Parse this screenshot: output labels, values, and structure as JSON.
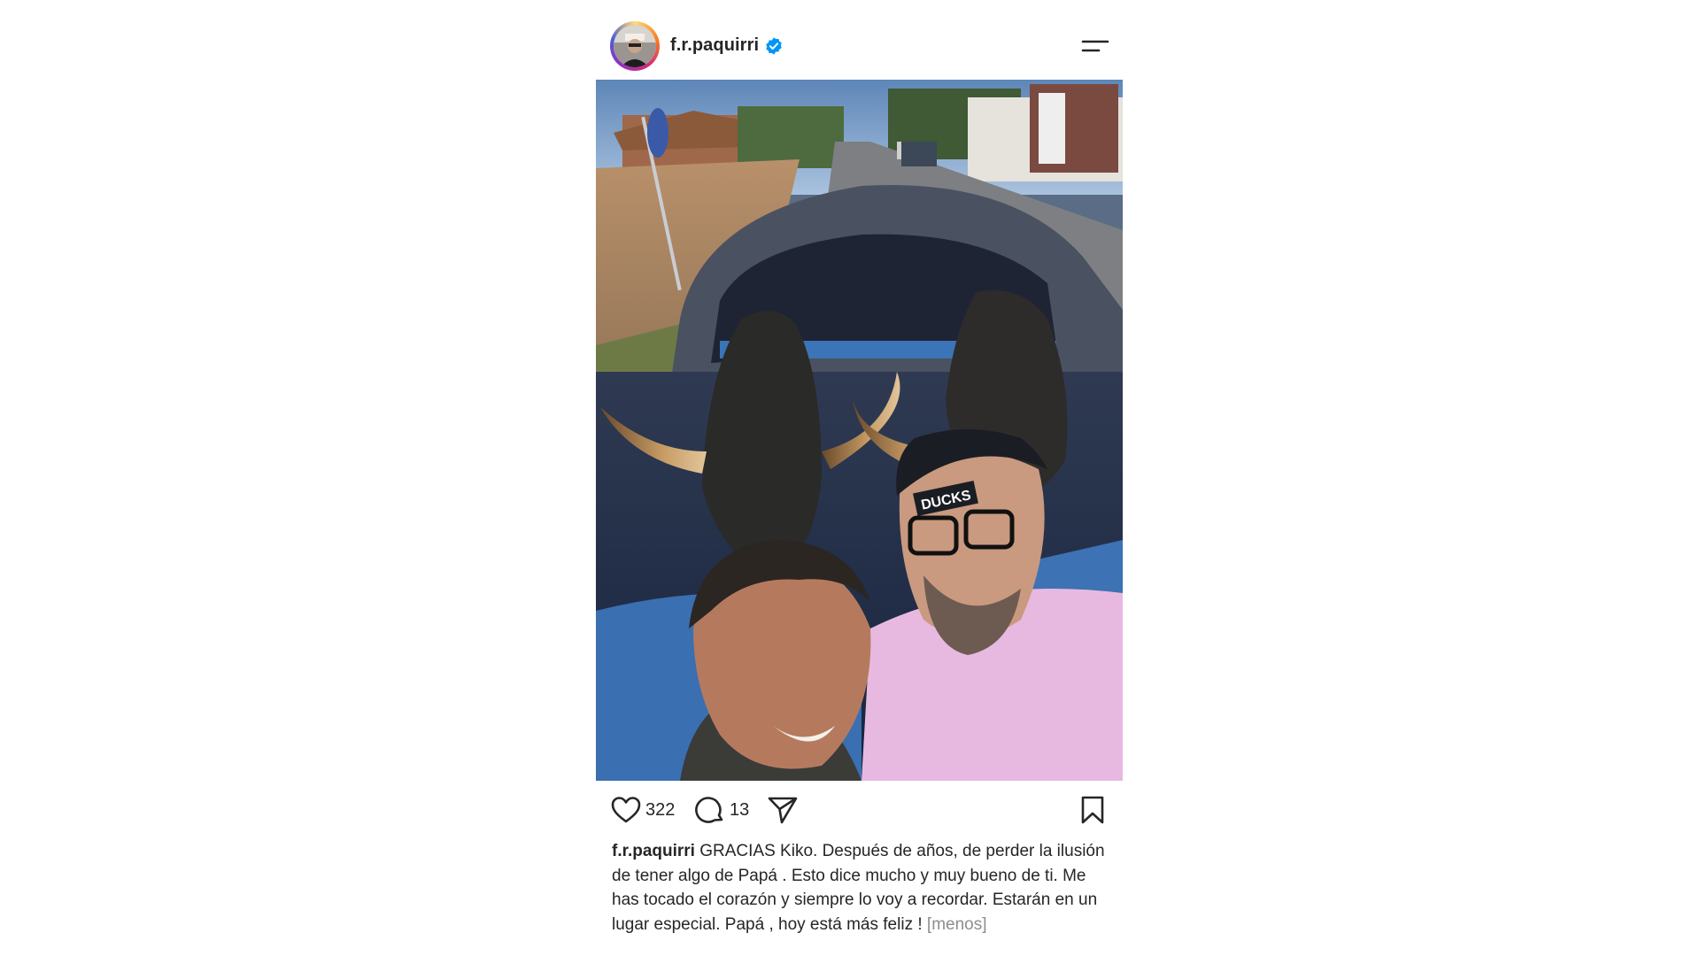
{
  "post": {
    "username": "f.r.paquirri",
    "verified": true,
    "likes": "322",
    "comments": "13",
    "caption": "GRACIAS Kiko. Después de años, de perder la ilusión de tener algo de Papá . Esto dice mucho y muy bueno de ti. Me has tocado el corazón y siempre lo voy a recordar. Estarán en un lugar especial. Papá , hoy está más feliz !",
    "less_label": "[menos]",
    "photo_cap_text": "DUCKS"
  },
  "icons": {
    "menu": "hamburger-menu-icon",
    "like": "heart-icon",
    "comment": "comment-bubble-icon",
    "share": "paper-plane-icon",
    "save": "bookmark-icon",
    "verified": "verified-badge-icon"
  },
  "colors": {
    "verified_blue": "#0095f6",
    "text": "#262626",
    "muted": "#8e8e8e"
  }
}
